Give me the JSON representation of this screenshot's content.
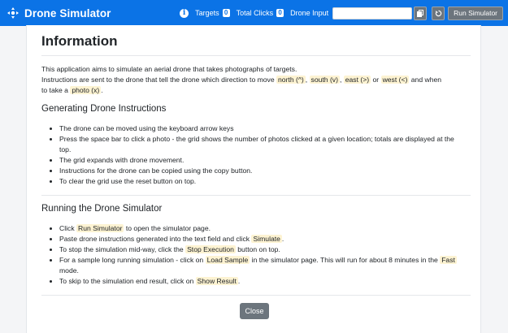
{
  "navbar": {
    "brand": "Drone Simulator",
    "info_icon": "i",
    "targets_label": "Targets",
    "targets_count": "0",
    "clicks_label": "Total Clicks",
    "clicks_count": "0",
    "drone_input_label": "Drone Input",
    "drone_input_value": "",
    "copy_icon": "copy-icon",
    "reset_icon": "reset-icon",
    "run_label": "Run Simulator",
    "brand_color": "#0b73e6"
  },
  "modal": {
    "title": "Information",
    "intro_1": "This application aims to simulate an aerial drone that takes photographs of targets.",
    "intro_2a": "Instructions are sent to the drone that tell the drone which direction to move",
    "code_north": "north (^)",
    "sep_1": ",",
    "code_south": "south (v)",
    "sep_2": ",",
    "code_east": "east (>)",
    "or_text": "or",
    "code_west": "west (<)",
    "intro_2b": "and when",
    "intro_3a": "to take a",
    "code_photo": "photo (x)",
    "intro_3b": ".",
    "section_1_title": "Generating Drone Instructions",
    "section_1_items": [
      "The drone can be moved using the keyboard arrow keys",
      "Press the space bar to click a photo - the grid shows the number of photos clicked at a given location; totals are displayed at the top.",
      "The grid expands with drone movement.",
      "Instructions for the drone can be copied using the copy button.",
      "To clear the grid use the reset button on top."
    ],
    "section_2_title": "Running the Drone Simulator",
    "s2_i1_a": "Click",
    "s2_i1_code": "Run Simulator",
    "s2_i1_b": "to open the simulator page.",
    "s2_i2_a": "Paste drone instructions generated into the text field and click",
    "s2_i2_code": "Simulate",
    "s2_i2_b": ".",
    "s2_i3_a": "To stop the simulation mid-way, click the",
    "s2_i3_code": "Stop Execution",
    "s2_i3_b": "button on top.",
    "s2_i4_a": "For a sample long running simulation - click on",
    "s2_i4_code": "Load Sample",
    "s2_i4_b": "in the simulator page. This will run for about 8 minutes in the",
    "s2_i4_code2": "Fast",
    "s2_i4_c": "mode.",
    "s2_i5_a": "To skip to the simulation end result, click on",
    "s2_i5_code": "Show Result",
    "s2_i5_b": ".",
    "close_label": "Close"
  }
}
